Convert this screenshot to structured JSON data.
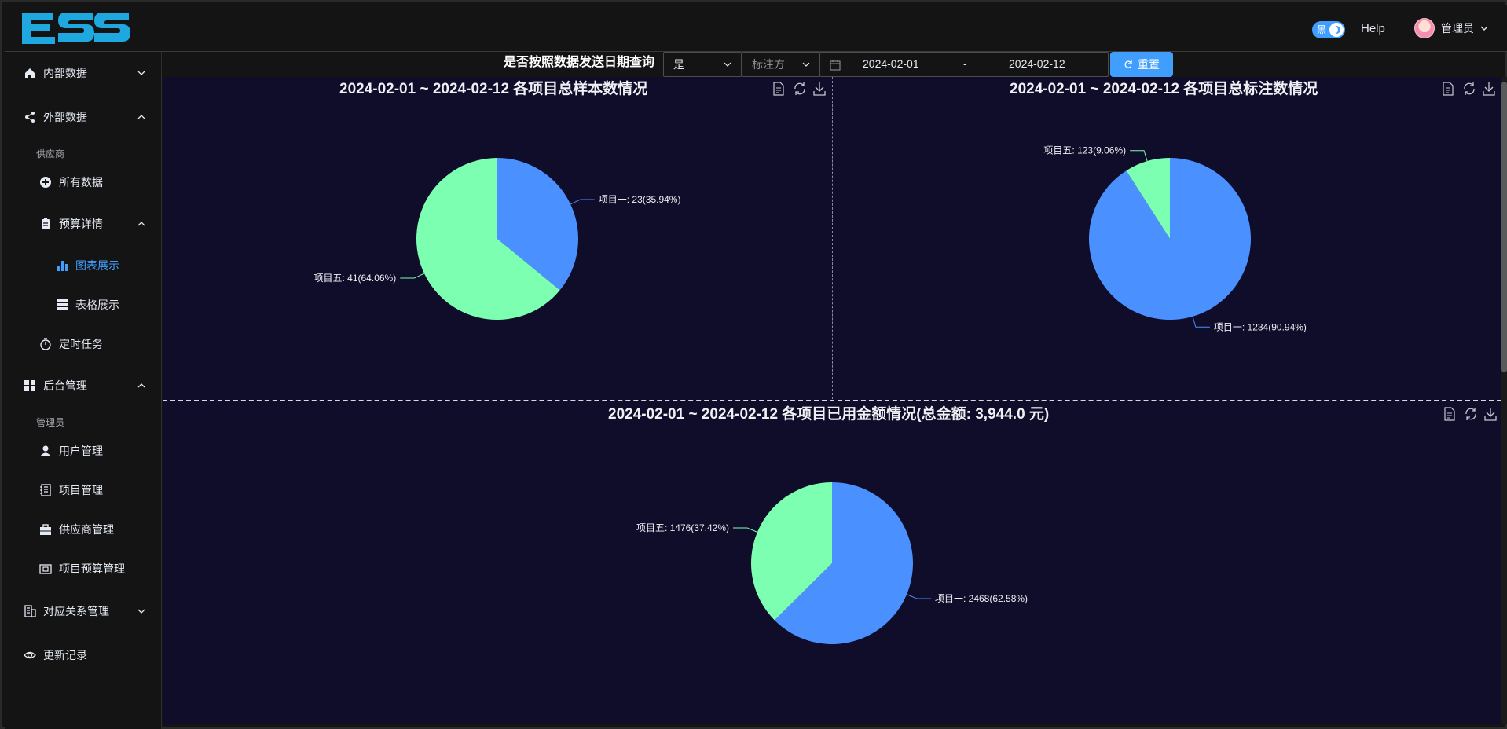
{
  "header": {
    "logo": "ESS",
    "theme_toggle_label": "黑",
    "help": "Help",
    "user_name": "管理员"
  },
  "sidebar": {
    "items": [
      {
        "label": "内部数据",
        "icon": "home-icon"
      },
      {
        "label": "外部数据",
        "icon": "share-icon"
      },
      {
        "group": "供应商"
      },
      {
        "label": "所有数据",
        "icon": "add-circle-icon"
      },
      {
        "label": "预算详情",
        "icon": "clipboard-icon"
      },
      {
        "label": "图表展示",
        "icon": "bar-chart-icon",
        "active": true
      },
      {
        "label": "表格展示",
        "icon": "grid-icon"
      },
      {
        "label": "定时任务",
        "icon": "timer-icon"
      },
      {
        "label": "后台管理",
        "icon": "dashboard-icon"
      },
      {
        "group": "管理员"
      },
      {
        "label": "用户管理",
        "icon": "user-icon"
      },
      {
        "label": "项目管理",
        "icon": "notebook-icon"
      },
      {
        "label": "供应商管理",
        "icon": "briefcase-icon"
      },
      {
        "label": "项目预算管理",
        "icon": "wallet-icon"
      },
      {
        "label": "对应关系管理",
        "icon": "office-building-icon"
      },
      {
        "label": "更新记录",
        "icon": "eye-icon"
      }
    ]
  },
  "filter": {
    "title": "是否按照数据发送日期查询",
    "mode_value": "是",
    "annotator_placeholder": "标注方",
    "start_date": "2024-02-01",
    "range_separator": "-",
    "end_date": "2024-02-12",
    "reset_label": "重置"
  },
  "colors": {
    "project1": "#4a90ff",
    "project5": "#7dffb2",
    "chart_bg": "#0f0d2a",
    "accent": "#409eff"
  },
  "chart_data": [
    {
      "type": "pie",
      "title": "2024-02-01 ~ 2024-02-12 各项目总样本数情况",
      "slices": [
        {
          "name": "项目一",
          "value": 23,
          "percent": "35.94%"
        },
        {
          "name": "项目五",
          "value": 41,
          "percent": "64.06%"
        }
      ],
      "labels": [
        "项目一: 23(35.94%)",
        "项目五: 41(64.06%)"
      ]
    },
    {
      "type": "pie",
      "title": "2024-02-01 ~ 2024-02-12 各项目总标注数情况",
      "slices": [
        {
          "name": "项目一",
          "value": 1234,
          "percent": "90.94%"
        },
        {
          "name": "项目五",
          "value": 123,
          "percent": "9.06%"
        }
      ],
      "labels": [
        "项目一: 1234(90.94%)",
        "项目五: 123(9.06%)"
      ]
    },
    {
      "type": "pie",
      "title": "2024-02-01 ~ 2024-02-12 各项目已用金额情况(总金额: 3,944.0 元)",
      "slices": [
        {
          "name": "项目一",
          "value": 2468,
          "percent": "62.58%"
        },
        {
          "name": "项目五",
          "value": 1476,
          "percent": "37.42%"
        }
      ],
      "labels": [
        "项目一: 2468(62.58%)",
        "项目五: 1476(37.42%)"
      ]
    }
  ]
}
